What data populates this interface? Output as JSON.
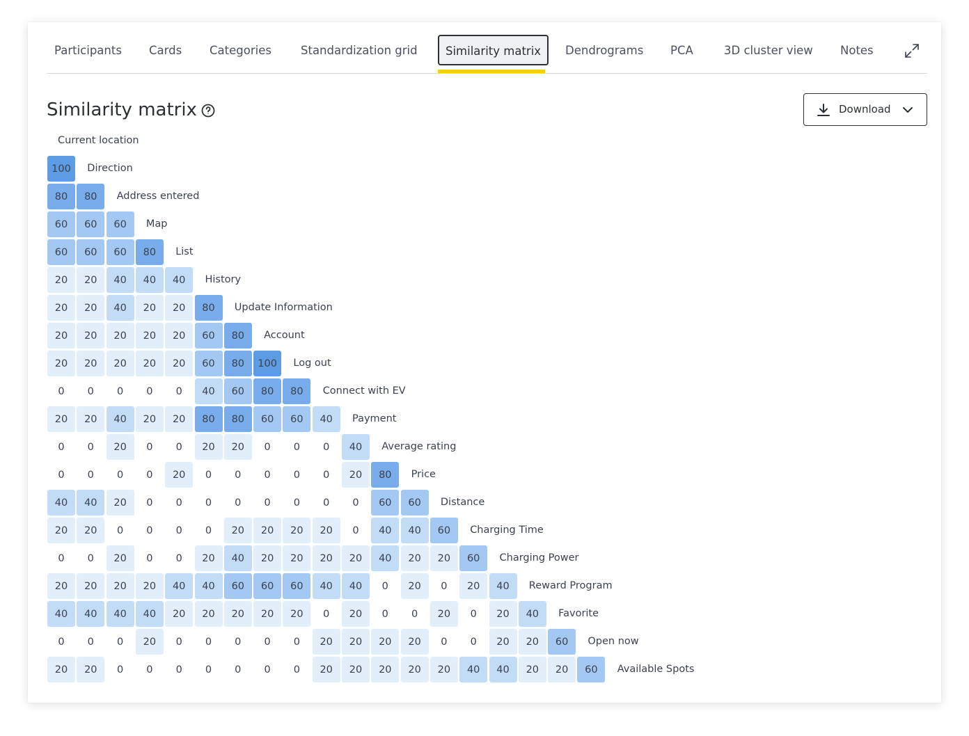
{
  "tabs": [
    {
      "label": "Participants",
      "name": "tab-participants",
      "active": false
    },
    {
      "label": "Cards",
      "name": "tab-cards",
      "active": false
    },
    {
      "label": "Categories",
      "name": "tab-categories",
      "active": false
    },
    {
      "label": "Standardization grid",
      "name": "tab-standardization-grid",
      "active": false
    },
    {
      "label": "Similarity matrix",
      "name": "tab-similarity-matrix",
      "active": true
    },
    {
      "label": "Dendrograms",
      "name": "tab-dendrograms",
      "active": false
    },
    {
      "label": "PCA",
      "name": "tab-pca",
      "active": false
    },
    {
      "label": "3D cluster view",
      "name": "tab-3d-cluster-view",
      "active": false
    },
    {
      "label": "Notes",
      "name": "tab-notes",
      "active": false
    }
  ],
  "header": {
    "title": "Similarity matrix",
    "download_label": "Download"
  },
  "icons": {
    "expand": "expand-icon",
    "help": "help-circle-icon",
    "download": "download-icon",
    "dropdown": "chevron-down-icon"
  },
  "colors": {
    "active_tab_underline": "#f6d000",
    "cell_100": "#5d9be3",
    "cell_80": "#78acea",
    "cell_60": "#a3c8f1",
    "cell_40": "#c3dcf6",
    "cell_20": "#e3eefb"
  },
  "chart_data": {
    "type": "heatmap",
    "labels": [
      "Current location",
      "Direction",
      "Address entered",
      "Map",
      "List",
      "History",
      "Update Information",
      "Account",
      "Log out",
      "Connect with EV",
      "Payment",
      "Average rating",
      "Price",
      "Distance",
      "Charging Time",
      "Charging Power",
      "Reward Program",
      "Favorite",
      "Open now",
      "Available Spots"
    ],
    "rows": [
      [],
      [
        100
      ],
      [
        80,
        80
      ],
      [
        60,
        60,
        60
      ],
      [
        60,
        60,
        60,
        80
      ],
      [
        20,
        20,
        40,
        40,
        40
      ],
      [
        20,
        20,
        40,
        20,
        20,
        80
      ],
      [
        20,
        20,
        20,
        20,
        20,
        60,
        80
      ],
      [
        20,
        20,
        20,
        20,
        20,
        60,
        80,
        100
      ],
      [
        0,
        0,
        0,
        0,
        0,
        40,
        60,
        80,
        80
      ],
      [
        20,
        20,
        40,
        20,
        20,
        80,
        80,
        60,
        60,
        40
      ],
      [
        0,
        0,
        20,
        0,
        0,
        20,
        20,
        0,
        0,
        0,
        40
      ],
      [
        0,
        0,
        0,
        0,
        20,
        0,
        0,
        0,
        0,
        0,
        20,
        80
      ],
      [
        40,
        40,
        20,
        0,
        0,
        0,
        0,
        0,
        0,
        0,
        0,
        60,
        60
      ],
      [
        20,
        20,
        0,
        0,
        0,
        0,
        20,
        20,
        20,
        20,
        0,
        40,
        40,
        60
      ],
      [
        0,
        0,
        20,
        0,
        0,
        20,
        40,
        20,
        20,
        20,
        20,
        40,
        20,
        20,
        60
      ],
      [
        20,
        20,
        20,
        20,
        40,
        40,
        60,
        60,
        60,
        40,
        40,
        0,
        20,
        0,
        20,
        40
      ],
      [
        40,
        40,
        40,
        40,
        20,
        20,
        20,
        20,
        20,
        0,
        20,
        0,
        0,
        20,
        0,
        20,
        40
      ],
      [
        0,
        0,
        0,
        20,
        0,
        0,
        0,
        0,
        0,
        20,
        20,
        20,
        20,
        0,
        0,
        20,
        20,
        60
      ],
      [
        20,
        20,
        0,
        0,
        0,
        0,
        0,
        0,
        0,
        20,
        20,
        20,
        20,
        20,
        40,
        40,
        20,
        20,
        60
      ]
    ],
    "value_range": [
      0,
      100
    ]
  }
}
